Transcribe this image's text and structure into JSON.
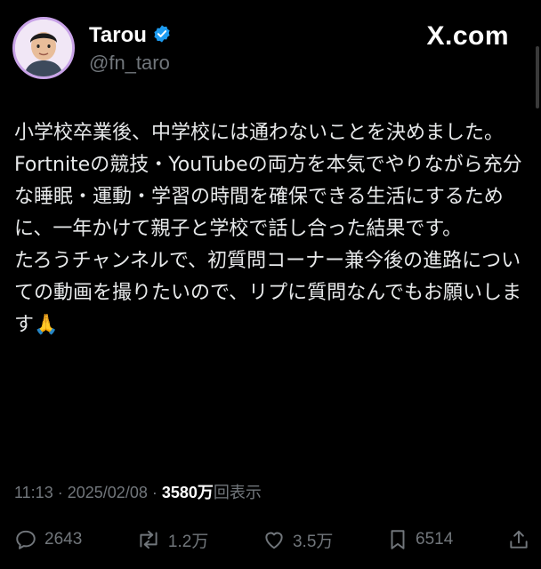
{
  "author": {
    "name": "Tarou",
    "handle": "@fn_taro",
    "verified_icon": "verified-badge-icon"
  },
  "brand": {
    "text": "X.com"
  },
  "tweet": {
    "lines": [
      "小学校卒業後、中学校には通わないことを決めました。",
      "Fortniteの競技・YouTubeの両方を本気でやりながら充分な睡眠・運動・学習の時間を確保できる生活にするために、一年かけて親子と学校で話し合った結果です。",
      "たろうチャンネルで、初質問コーナー兼今後の進路についての動画を撮りたいので、リプに質問なんでもお願いします🙏"
    ]
  },
  "meta": {
    "time": "11:13",
    "date": "2025/02/08",
    "views_count": "3580万",
    "views_label": "回表示",
    "sep": "·"
  },
  "actions": {
    "replies": "2643",
    "reposts": "1.2万",
    "likes": "3.5万",
    "bookmarks": "6514"
  },
  "colors": {
    "background": "#000000",
    "text": "#e7e9ea",
    "muted": "#71767b",
    "verified": "#1d9bf0",
    "avatar_ring": "#c9a3e8"
  }
}
